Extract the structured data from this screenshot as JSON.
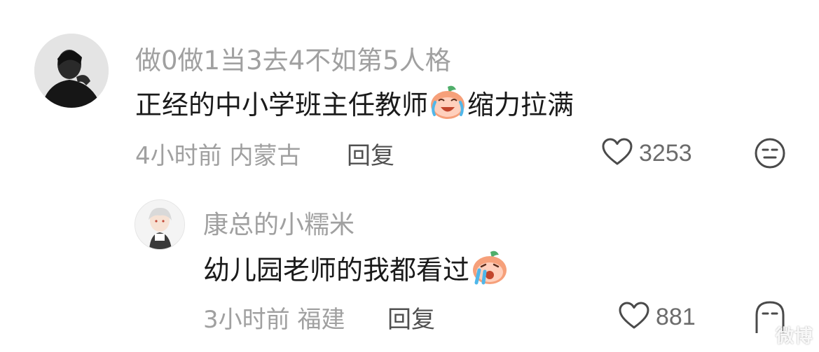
{
  "comments": [
    {
      "username": "做0做1当3去4不如第5人格",
      "text": "正经的中小学班主任教师",
      "emoji": "crying-laughing-peach-emoji",
      "text_after": "缩力拉满",
      "meta": "4小时前 内蒙古",
      "reply_label": "回复",
      "likes": "3253",
      "icons": {
        "like": "heart-outline-icon",
        "reaction": "neutral-face-icon"
      }
    }
  ],
  "reply": {
    "username": "康总的小糯米",
    "text": "幼儿园老师的我都看过",
    "emoji": "crying-peach-emoji",
    "meta": "3小时前 福建",
    "reply_label": "回复",
    "likes": "881",
    "icons": {
      "like": "heart-outline-icon",
      "reaction": "neutral-face-icon"
    }
  },
  "colors": {
    "username": "#a0a0a0",
    "text": "#1a1a1a",
    "meta": "#a0a0a0",
    "peach": "#f6a07a"
  },
  "watermark": "微博"
}
